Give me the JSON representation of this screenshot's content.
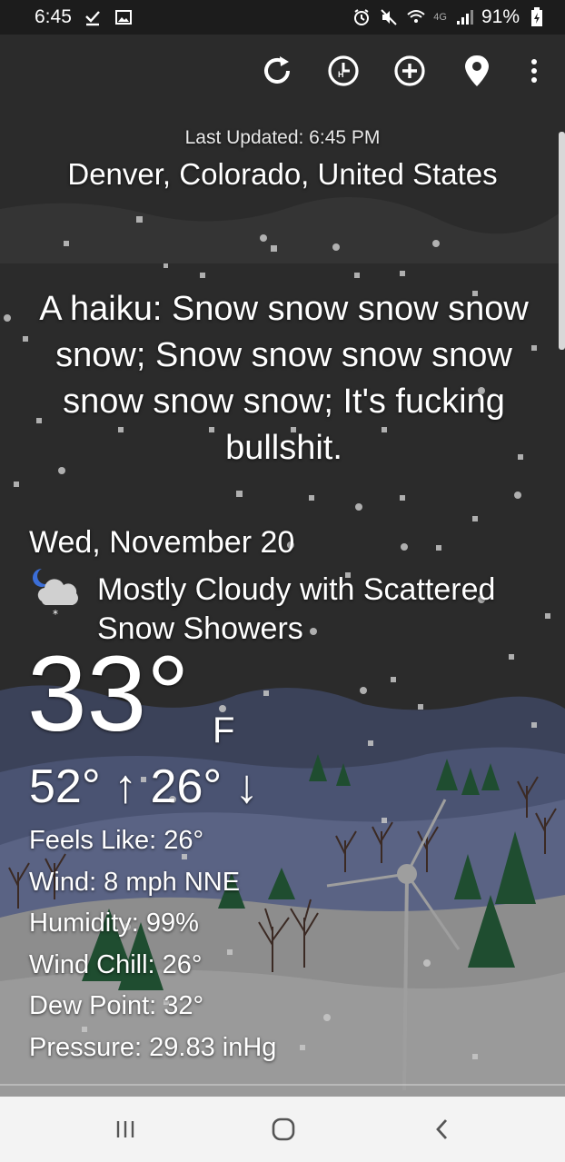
{
  "status_bar": {
    "time": "6:45",
    "battery": "91%",
    "network": "4G"
  },
  "toolbar": {
    "icons": [
      "refresh-icon",
      "history-icon",
      "add-location-icon",
      "location-pin-icon",
      "overflow-menu-icon"
    ]
  },
  "header": {
    "last_updated": "Last Updated: 6:45 PM",
    "location": "Denver, Colorado, United States"
  },
  "haiku": "A haiku: Snow snow snow snow snow; Snow snow snow snow snow snow snow; It's fucking bullshit.",
  "forecast": {
    "date": "Wed, November 20",
    "condition": "Mostly Cloudy with Scattered Snow Showers",
    "condition_icon": "night-cloudy-snow-icon",
    "temperature": "33°",
    "unit": "F",
    "high_low": "52° ↑ 26° ↓",
    "details": {
      "feels_like": "Feels Like: 26°",
      "wind": "Wind: 8 mph NNE",
      "humidity": "Humidity: 99%",
      "wind_chill": "Wind Chill: 26°",
      "dew_point": "Dew Point: 32°",
      "pressure": "Pressure: 29.83 inHg"
    }
  },
  "nav_bar": {
    "buttons": [
      "recent-apps-icon",
      "home-icon",
      "back-icon"
    ]
  },
  "colors": {
    "sky": "#2b2b2b",
    "hills": "#3f4560",
    "snow_ground": "#8d8d8d",
    "trees": "#1e4a2e",
    "nav_bar": "#f3f3f3"
  }
}
